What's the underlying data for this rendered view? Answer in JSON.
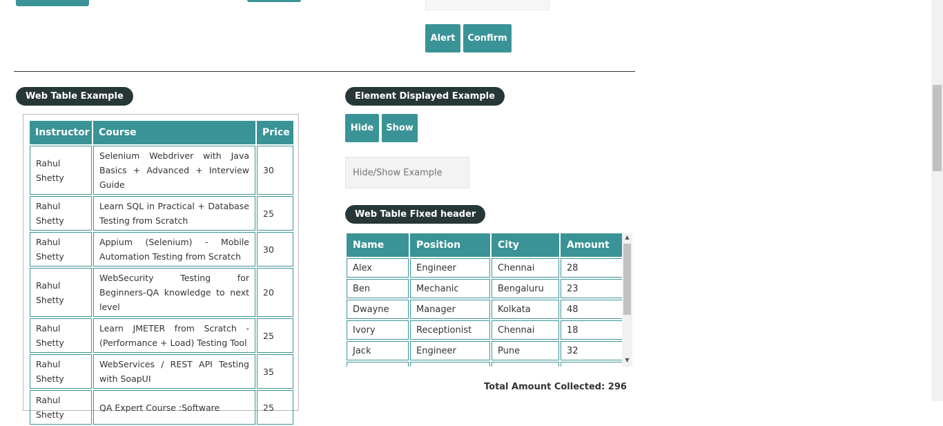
{
  "top_buttons": {
    "alert_label": "Alert",
    "confirm_label": "Confirm"
  },
  "sections": {
    "web_table": "Web Table Example",
    "element_displayed": "Element Displayed Example",
    "fixed_header": "Web Table Fixed header"
  },
  "web_table": {
    "headers": [
      "Instructor",
      "Course",
      "Price"
    ],
    "rows": [
      {
        "instructor": "Rahul Shetty",
        "course": "Selenium Webdriver with Java Basics + Advanced + Interview Guide",
        "price": "30"
      },
      {
        "instructor": "Rahul Shetty",
        "course": "Learn SQL in Practical + Database Testing from Scratch",
        "price": "25"
      },
      {
        "instructor": "Rahul Shetty",
        "course": "Appium (Selenium) - Mobile Automation Testing from Scratch",
        "price": "30"
      },
      {
        "instructor": "Rahul Shetty",
        "course": "WebSecurity Testing for Beginners-QA knowledge to next level",
        "price": "20"
      },
      {
        "instructor": "Rahul Shetty",
        "course": "Learn JMETER from Scratch - (Performance + Load) Testing Tool",
        "price": "25"
      },
      {
        "instructor": "Rahul Shetty",
        "course": "WebServices / REST API Testing with SoapUI",
        "price": "35"
      },
      {
        "instructor": "Rahul Shetty",
        "course": "QA Expert Course :Software",
        "price": "25"
      }
    ]
  },
  "element_displayed": {
    "hide_label": "Hide",
    "show_label": "Show",
    "input_placeholder": "Hide/Show Example"
  },
  "fixed_table": {
    "headers": [
      "Name",
      "Position",
      "City",
      "Amount"
    ],
    "rows": [
      {
        "name": "Alex",
        "position": "Engineer",
        "city": "Chennai",
        "amount": "28"
      },
      {
        "name": "Ben",
        "position": "Mechanic",
        "city": "Bengaluru",
        "amount": "23"
      },
      {
        "name": "Dwayne",
        "position": "Manager",
        "city": "Kolkata",
        "amount": "48"
      },
      {
        "name": "Ivory",
        "position": "Receptionist",
        "city": "Chennai",
        "amount": "18"
      },
      {
        "name": "Jack",
        "position": "Engineer",
        "city": "Pune",
        "amount": "32"
      },
      {
        "name": "",
        "position": "",
        "city": "",
        "amount": ""
      }
    ]
  },
  "total_amount": "Total Amount Collected: 296",
  "icons": {
    "scroll_up": "scroll-up-arrow-icon",
    "scroll_down": "scroll-down-arrow-icon"
  },
  "colors": {
    "accent": "#3a9396",
    "pill": "#273738"
  }
}
